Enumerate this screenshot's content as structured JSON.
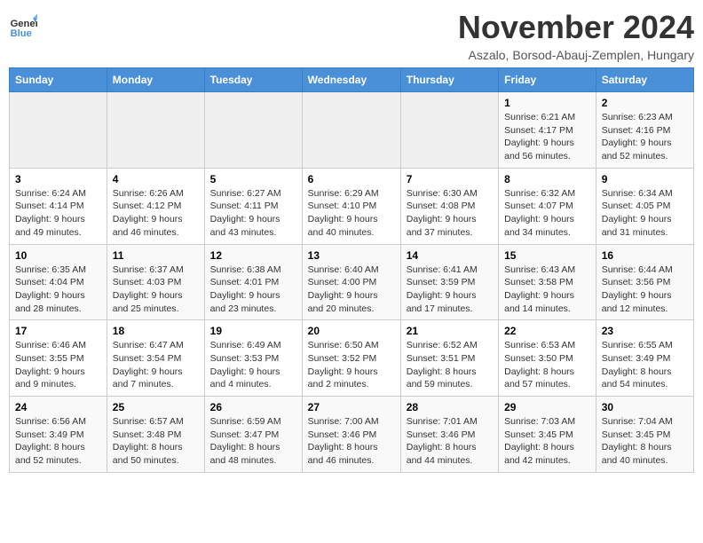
{
  "logo": {
    "text_general": "General",
    "text_blue": "Blue"
  },
  "title": "November 2024",
  "subtitle": "Aszalo, Borsod-Abauj-Zemplen, Hungary",
  "days_of_week": [
    "Sunday",
    "Monday",
    "Tuesday",
    "Wednesday",
    "Thursday",
    "Friday",
    "Saturday"
  ],
  "weeks": [
    [
      {
        "day": "",
        "info": ""
      },
      {
        "day": "",
        "info": ""
      },
      {
        "day": "",
        "info": ""
      },
      {
        "day": "",
        "info": ""
      },
      {
        "day": "",
        "info": ""
      },
      {
        "day": "1",
        "info": "Sunrise: 6:21 AM\nSunset: 4:17 PM\nDaylight: 9 hours and 56 minutes."
      },
      {
        "day": "2",
        "info": "Sunrise: 6:23 AM\nSunset: 4:16 PM\nDaylight: 9 hours and 52 minutes."
      }
    ],
    [
      {
        "day": "3",
        "info": "Sunrise: 6:24 AM\nSunset: 4:14 PM\nDaylight: 9 hours and 49 minutes."
      },
      {
        "day": "4",
        "info": "Sunrise: 6:26 AM\nSunset: 4:12 PM\nDaylight: 9 hours and 46 minutes."
      },
      {
        "day": "5",
        "info": "Sunrise: 6:27 AM\nSunset: 4:11 PM\nDaylight: 9 hours and 43 minutes."
      },
      {
        "day": "6",
        "info": "Sunrise: 6:29 AM\nSunset: 4:10 PM\nDaylight: 9 hours and 40 minutes."
      },
      {
        "day": "7",
        "info": "Sunrise: 6:30 AM\nSunset: 4:08 PM\nDaylight: 9 hours and 37 minutes."
      },
      {
        "day": "8",
        "info": "Sunrise: 6:32 AM\nSunset: 4:07 PM\nDaylight: 9 hours and 34 minutes."
      },
      {
        "day": "9",
        "info": "Sunrise: 6:34 AM\nSunset: 4:05 PM\nDaylight: 9 hours and 31 minutes."
      }
    ],
    [
      {
        "day": "10",
        "info": "Sunrise: 6:35 AM\nSunset: 4:04 PM\nDaylight: 9 hours and 28 minutes."
      },
      {
        "day": "11",
        "info": "Sunrise: 6:37 AM\nSunset: 4:03 PM\nDaylight: 9 hours and 25 minutes."
      },
      {
        "day": "12",
        "info": "Sunrise: 6:38 AM\nSunset: 4:01 PM\nDaylight: 9 hours and 23 minutes."
      },
      {
        "day": "13",
        "info": "Sunrise: 6:40 AM\nSunset: 4:00 PM\nDaylight: 9 hours and 20 minutes."
      },
      {
        "day": "14",
        "info": "Sunrise: 6:41 AM\nSunset: 3:59 PM\nDaylight: 9 hours and 17 minutes."
      },
      {
        "day": "15",
        "info": "Sunrise: 6:43 AM\nSunset: 3:58 PM\nDaylight: 9 hours and 14 minutes."
      },
      {
        "day": "16",
        "info": "Sunrise: 6:44 AM\nSunset: 3:56 PM\nDaylight: 9 hours and 12 minutes."
      }
    ],
    [
      {
        "day": "17",
        "info": "Sunrise: 6:46 AM\nSunset: 3:55 PM\nDaylight: 9 hours and 9 minutes."
      },
      {
        "day": "18",
        "info": "Sunrise: 6:47 AM\nSunset: 3:54 PM\nDaylight: 9 hours and 7 minutes."
      },
      {
        "day": "19",
        "info": "Sunrise: 6:49 AM\nSunset: 3:53 PM\nDaylight: 9 hours and 4 minutes."
      },
      {
        "day": "20",
        "info": "Sunrise: 6:50 AM\nSunset: 3:52 PM\nDaylight: 9 hours and 2 minutes."
      },
      {
        "day": "21",
        "info": "Sunrise: 6:52 AM\nSunset: 3:51 PM\nDaylight: 8 hours and 59 minutes."
      },
      {
        "day": "22",
        "info": "Sunrise: 6:53 AM\nSunset: 3:50 PM\nDaylight: 8 hours and 57 minutes."
      },
      {
        "day": "23",
        "info": "Sunrise: 6:55 AM\nSunset: 3:49 PM\nDaylight: 8 hours and 54 minutes."
      }
    ],
    [
      {
        "day": "24",
        "info": "Sunrise: 6:56 AM\nSunset: 3:49 PM\nDaylight: 8 hours and 52 minutes."
      },
      {
        "day": "25",
        "info": "Sunrise: 6:57 AM\nSunset: 3:48 PM\nDaylight: 8 hours and 50 minutes."
      },
      {
        "day": "26",
        "info": "Sunrise: 6:59 AM\nSunset: 3:47 PM\nDaylight: 8 hours and 48 minutes."
      },
      {
        "day": "27",
        "info": "Sunrise: 7:00 AM\nSunset: 3:46 PM\nDaylight: 8 hours and 46 minutes."
      },
      {
        "day": "28",
        "info": "Sunrise: 7:01 AM\nSunset: 3:46 PM\nDaylight: 8 hours and 44 minutes."
      },
      {
        "day": "29",
        "info": "Sunrise: 7:03 AM\nSunset: 3:45 PM\nDaylight: 8 hours and 42 minutes."
      },
      {
        "day": "30",
        "info": "Sunrise: 7:04 AM\nSunset: 3:45 PM\nDaylight: 8 hours and 40 minutes."
      }
    ]
  ]
}
